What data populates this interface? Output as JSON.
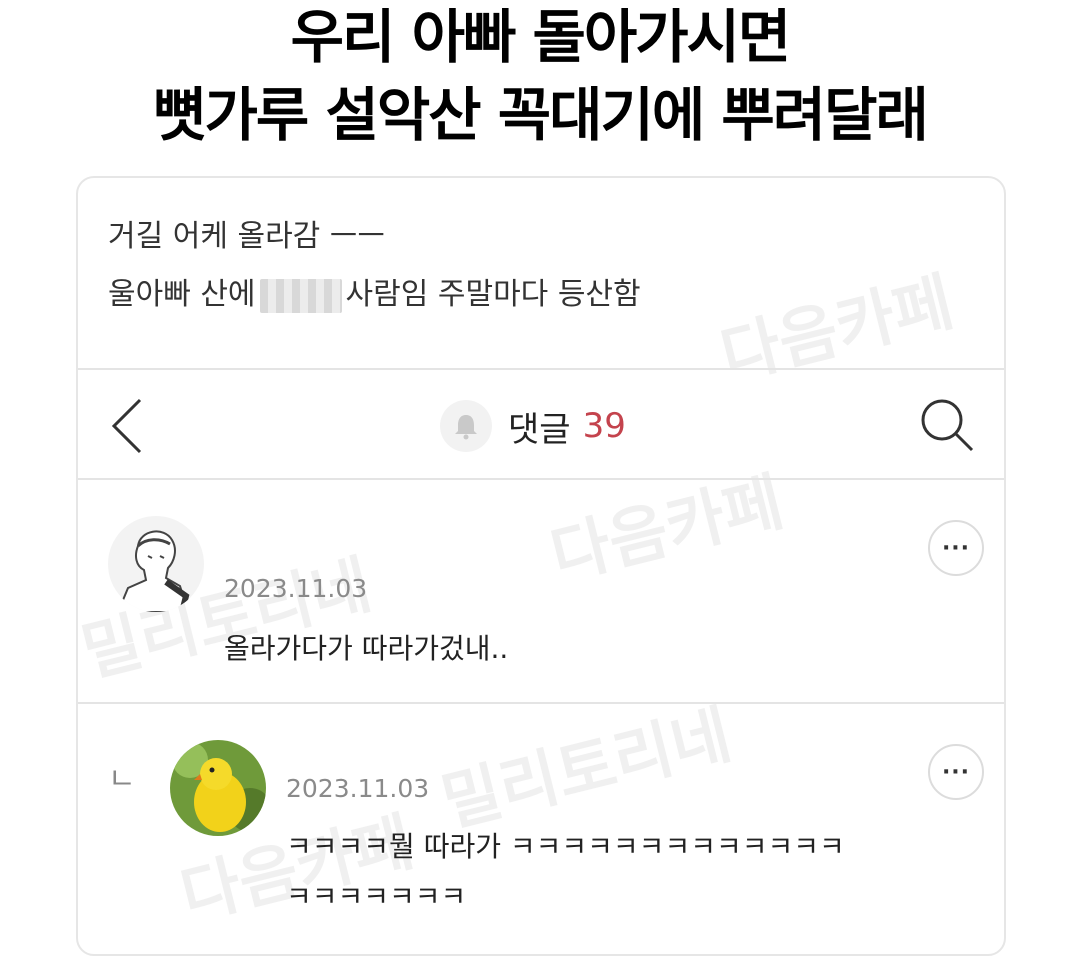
{
  "caption": {
    "line1": "우리 아빠 돌아가시면",
    "line2": "뼛가루 설악산 꼭대기에 뿌려달래"
  },
  "post": {
    "line1": "거길 어케 올라감 ㅡㅡ",
    "line2_before": "울아빠 산에",
    "line2_after": "사람임 주말마다 등산함"
  },
  "nav": {
    "label": "댓글",
    "count": "39"
  },
  "comments": [
    {
      "date": "2023.11.03",
      "text": "올라가다가 따라가겄내.."
    },
    {
      "reply_marker": "ㄴ",
      "date": "2023.11.03",
      "text_line1": "ㅋㅋㅋㅋ뭘 따라가 ㅋㅋㅋㅋㅋㅋㅋㅋㅋㅋㅋㅋㅋ",
      "text_line2": "ㅋㅋㅋㅋㅋㅋㅋ"
    }
  ],
  "more_label": "···",
  "watermark": {
    "daum": "다음카페",
    "military": "밀리토리네"
  },
  "colors": {
    "accent_count": "#c4434d",
    "date_gray": "#8a8a8a",
    "divider": "#e4e4e4"
  },
  "icons": [
    "back-chevron-icon",
    "bell-icon",
    "search-icon",
    "more-icon",
    "avatar-sketch",
    "avatar-parrot"
  ]
}
